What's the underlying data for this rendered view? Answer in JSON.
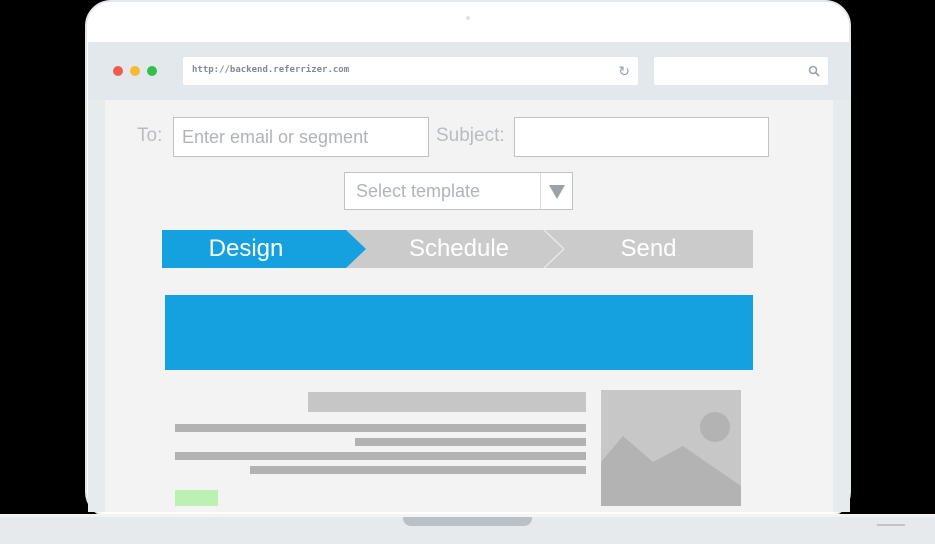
{
  "browser": {
    "url": "http://backend.referrizer.com",
    "search_value": "",
    "refresh_icon": "refresh-icon",
    "search_icon": "search-icon",
    "window_controls": [
      "close-dot",
      "minimize-dot",
      "maximize-dot"
    ]
  },
  "composer": {
    "to_label": "To:",
    "to_placeholder": "Enter email or segment",
    "subject_label": "Subject:",
    "subject_value": "",
    "template_select": "Select template"
  },
  "steps": {
    "design": "Design",
    "schedule": "Schedule",
    "send": "Send",
    "active": "Design"
  },
  "colors": {
    "accent": "#15a1df",
    "inactive_step": "#cbcbcb",
    "cta": "#bdf0b3",
    "traffic_red": "#f05b4f",
    "traffic_yellow": "#f6ba2e",
    "traffic_green": "#33c04a"
  }
}
